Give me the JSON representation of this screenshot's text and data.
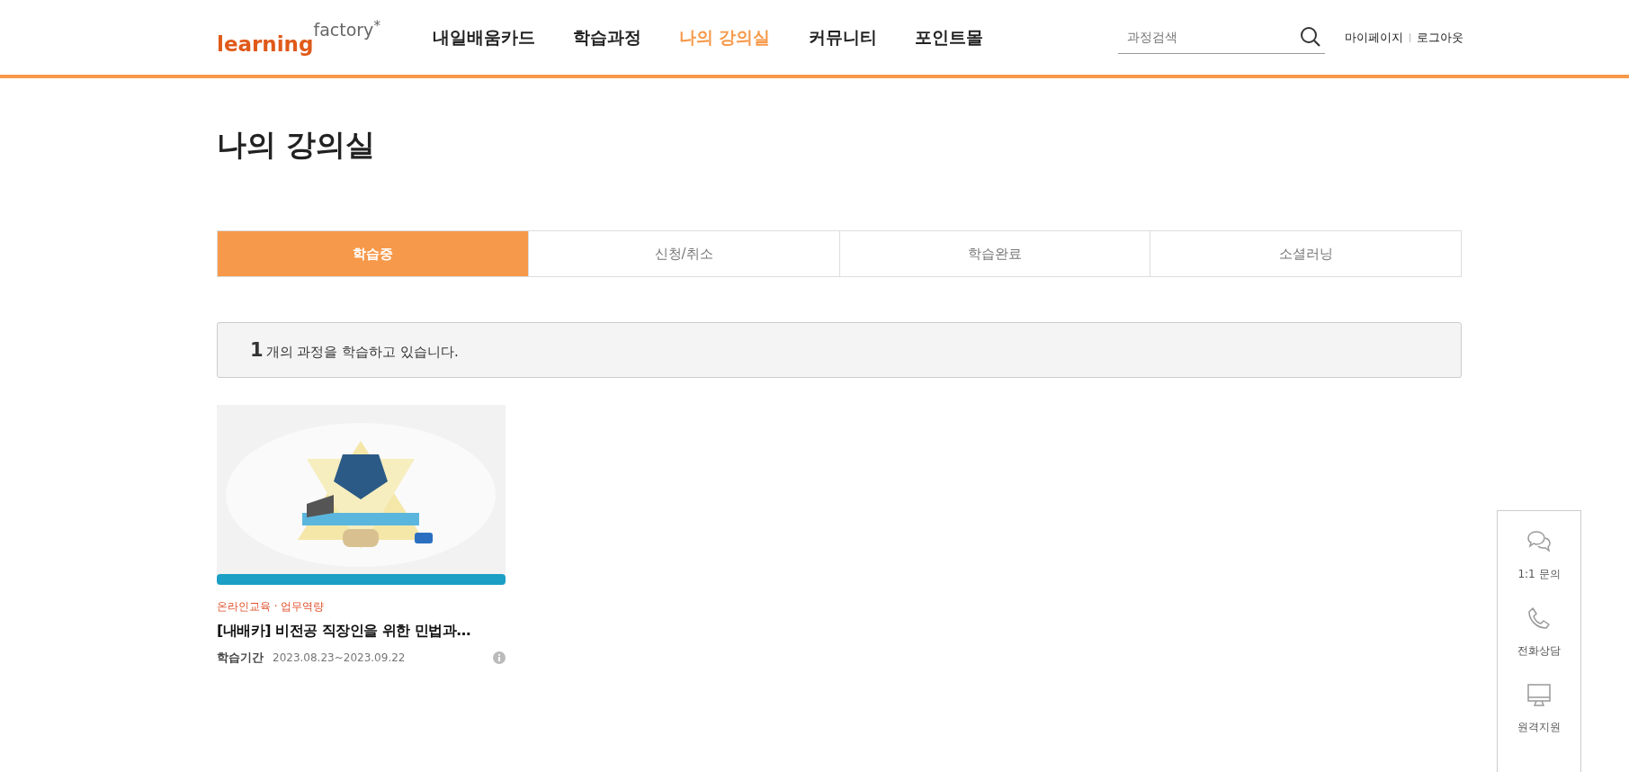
{
  "header": {
    "logo": {
      "main": "learning",
      "sup": "factory",
      "mark": "*"
    },
    "nav": [
      {
        "label": "내일배움카드",
        "selected": false
      },
      {
        "label": "학습과정",
        "selected": false
      },
      {
        "label": "나의 강의실",
        "selected": true
      },
      {
        "label": "커뮤니티",
        "selected": false
      },
      {
        "label": "포인트몰",
        "selected": false
      }
    ],
    "search": {
      "placeholder": "과정검색"
    },
    "user_links": [
      "마이페이지",
      "로그아웃"
    ]
  },
  "page_title": "나의 강의실",
  "tabs": [
    {
      "label": "학습중",
      "selected": true
    },
    {
      "label": "신청/취소",
      "selected": false
    },
    {
      "label": "학습완료",
      "selected": false
    },
    {
      "label": "소셜러닝",
      "selected": false
    }
  ],
  "summary": {
    "count": "1",
    "text": "개의 과정을 학습하고 있습니다."
  },
  "courses": [
    {
      "category": "온라인교육 · 업무역량",
      "title": "[내배카] 비전공 직장인을 위한 민법과…",
      "period_label": "학습기간",
      "period": "2023.08.23~2023.09.22"
    }
  ],
  "quick_menu": [
    {
      "kind": "chat",
      "label": "1:1 문의"
    },
    {
      "kind": "phone",
      "label": "전화상담"
    },
    {
      "kind": "monitor",
      "label": "원격지원"
    }
  ]
}
